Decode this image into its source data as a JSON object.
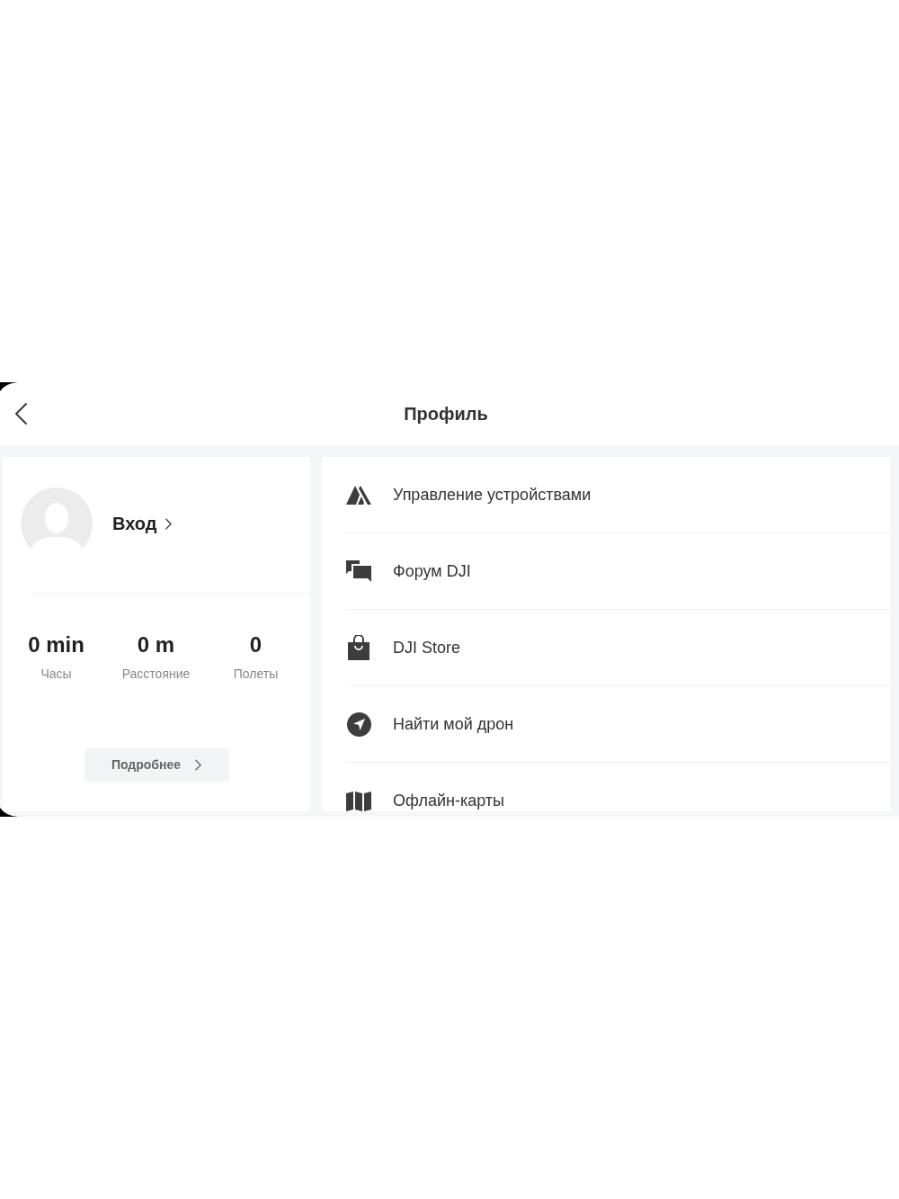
{
  "header": {
    "title": "Профиль"
  },
  "profile": {
    "login_label": "Вход",
    "stats": [
      {
        "value": "0 min",
        "label": "Часы"
      },
      {
        "value": "0 m",
        "label": "Расстояние"
      },
      {
        "value": "0",
        "label": "Полеты"
      }
    ],
    "details_button": "Подробнее"
  },
  "menu": [
    {
      "label": "Управление устройствами"
    },
    {
      "label": "Форум DJI"
    },
    {
      "label": "DJI Store"
    },
    {
      "label": "Найти мой дрон"
    },
    {
      "label": "Офлайн-карты"
    }
  ]
}
